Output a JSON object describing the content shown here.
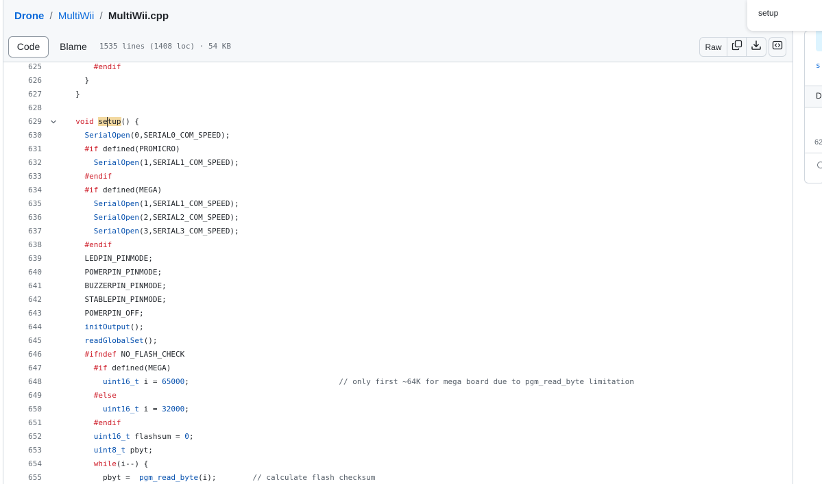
{
  "breadcrumb": {
    "repo": "Drone",
    "folder": "MultiWii",
    "file": "MultiWii.cpp",
    "sep": "/"
  },
  "toolbar": {
    "code_tab": "Code",
    "blame_tab": "Blame",
    "file_info": "1535 lines (1408 loc) · 54 KB",
    "raw_label": "Raw"
  },
  "search": {
    "value": "setup"
  },
  "right_panel": {
    "s_text": "s",
    "d_text": "D",
    "line_text": "62"
  },
  "icons": {
    "copy": "copy-icon",
    "download": "download-icon",
    "symbols": "symbols-icon",
    "fold": "chevron-down-icon"
  },
  "code_lines": [
    {
      "num": "625",
      "code": "      #endif"
    },
    {
      "num": "626",
      "code": "    }"
    },
    {
      "num": "627",
      "code": "  }"
    },
    {
      "num": "628",
      "code": ""
    },
    {
      "num": "629",
      "code": "  void setup() {"
    },
    {
      "num": "630",
      "code": "    SerialOpen(0,SERIAL0_COM_SPEED);"
    },
    {
      "num": "631",
      "code": "    #if defined(PROMICRO)"
    },
    {
      "num": "632",
      "code": "      SerialOpen(1,SERIAL1_COM_SPEED);"
    },
    {
      "num": "633",
      "code": "    #endif"
    },
    {
      "num": "634",
      "code": "    #if defined(MEGA)"
    },
    {
      "num": "635",
      "code": "      SerialOpen(1,SERIAL1_COM_SPEED);"
    },
    {
      "num": "636",
      "code": "      SerialOpen(2,SERIAL2_COM_SPEED);"
    },
    {
      "num": "637",
      "code": "      SerialOpen(3,SERIAL3_COM_SPEED);"
    },
    {
      "num": "638",
      "code": "    #endif"
    },
    {
      "num": "639",
      "code": "    LEDPIN_PINMODE;"
    },
    {
      "num": "640",
      "code": "    POWERPIN_PINMODE;"
    },
    {
      "num": "641",
      "code": "    BUZZERPIN_PINMODE;"
    },
    {
      "num": "642",
      "code": "    STABLEPIN_PINMODE;"
    },
    {
      "num": "643",
      "code": "    POWERPIN_OFF;"
    },
    {
      "num": "644",
      "code": "    initOutput();"
    },
    {
      "num": "645",
      "code": "    readGlobalSet();"
    },
    {
      "num": "646",
      "code": "    #ifndef NO_FLASH_CHECK"
    },
    {
      "num": "647",
      "code": "      #if defined(MEGA)"
    },
    {
      "num": "648",
      "code": "        uint16_t i = 65000;                                 // only first ~64K for mega board due to pgm_read_byte limitation"
    },
    {
      "num": "649",
      "code": "      #else"
    },
    {
      "num": "650",
      "code": "        uint16_t i = 32000;"
    },
    {
      "num": "651",
      "code": "      #endif"
    },
    {
      "num": "652",
      "code": "      uint16_t flashsum = 0;"
    },
    {
      "num": "653",
      "code": "      uint8_t pbyt;"
    },
    {
      "num": "654",
      "code": "      while(i--) {"
    },
    {
      "num": "655",
      "code": "        pbyt =  pgm_read_byte(i);        // calculate flash checksum"
    }
  ]
}
